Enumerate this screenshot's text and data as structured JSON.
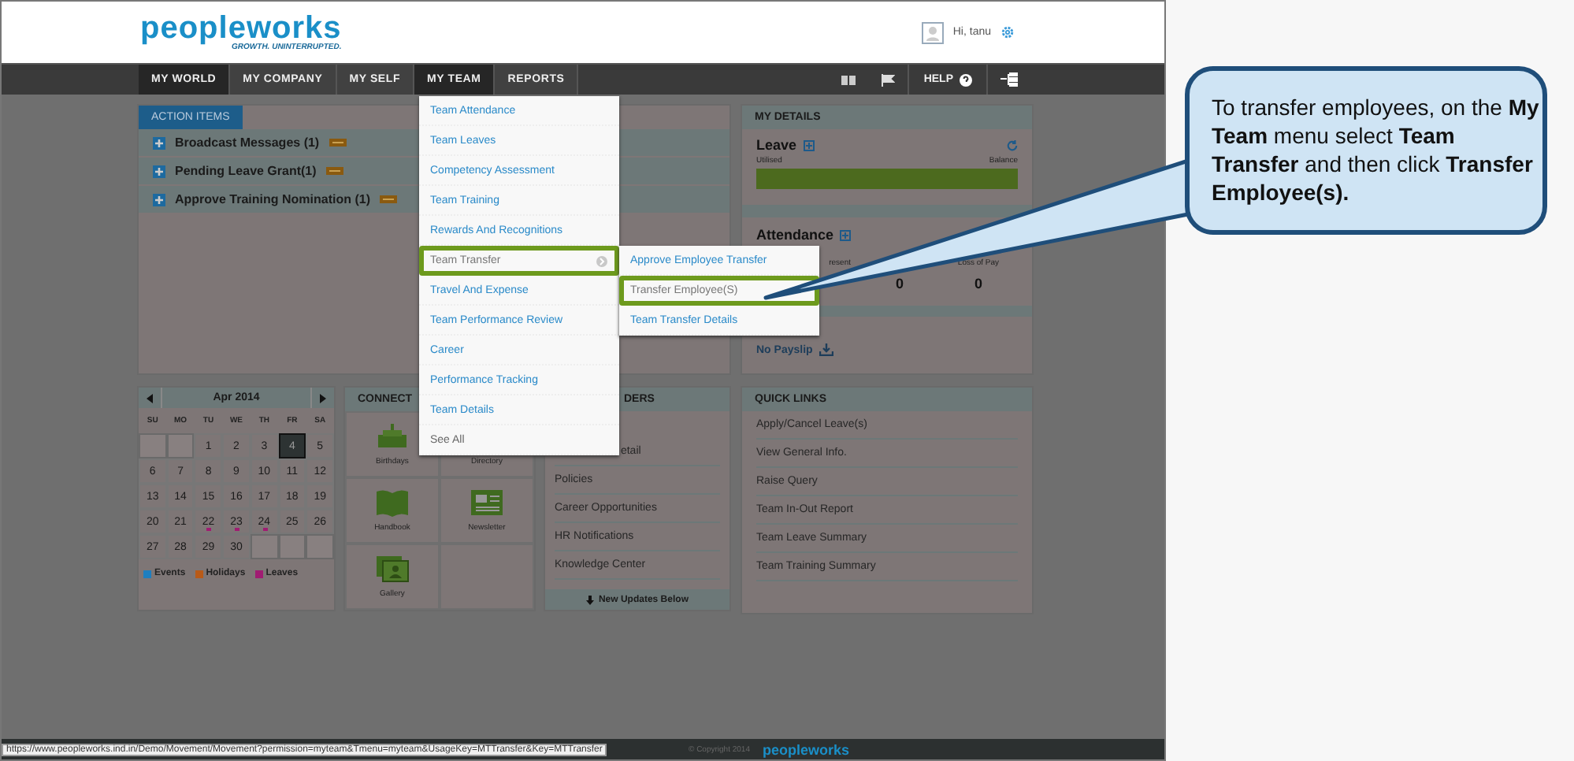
{
  "header": {
    "logo": "peopleworks",
    "tagline": "GROWTH. UNINTERRUPTED.",
    "greeting": "Hi, tanu"
  },
  "nav": {
    "items": [
      {
        "label": "MY WORLD",
        "active": true
      },
      {
        "label": "MY COMPANY",
        "active": false
      },
      {
        "label": "MY SELF",
        "active": false
      },
      {
        "label": "MY TEAM",
        "active": true
      },
      {
        "label": "REPORTS",
        "active": false
      }
    ],
    "help": "HELP"
  },
  "menu": {
    "items": [
      {
        "label": "Team Attendance",
        "kind": "link",
        "selected": false
      },
      {
        "label": "Team Leaves",
        "kind": "link",
        "selected": false
      },
      {
        "label": "Competency Assessment",
        "kind": "link",
        "selected": false
      },
      {
        "label": "Team Training",
        "kind": "link",
        "selected": false
      },
      {
        "label": "Rewards And Recognitions",
        "kind": "link",
        "selected": false
      },
      {
        "label": "Team Transfer",
        "kind": "submenu",
        "selected": true
      },
      {
        "label": "Travel And Expense",
        "kind": "link",
        "selected": false
      },
      {
        "label": "Team Performance Review",
        "kind": "link",
        "selected": false
      },
      {
        "label": "Career",
        "kind": "link",
        "selected": false
      },
      {
        "label": "Performance Tracking",
        "kind": "link",
        "selected": false
      },
      {
        "label": "Team Details",
        "kind": "link",
        "selected": false
      },
      {
        "label": "See All",
        "kind": "more",
        "selected": false
      }
    ],
    "submenu": [
      {
        "label": "Approve Employee Transfer",
        "selected": false
      },
      {
        "label": "Transfer Employee(S)",
        "selected": true
      },
      {
        "label": "Team Transfer Details",
        "selected": false
      }
    ]
  },
  "action_items": {
    "tab": "ACTION ITEMS",
    "rows": [
      {
        "label": "Broadcast Messages (1)",
        "new": true
      },
      {
        "label": "Pending Leave Grant(1)",
        "new": true
      },
      {
        "label": "Approve Training Nomination (1)",
        "new": true
      }
    ]
  },
  "calendar": {
    "month": "Apr 2014",
    "weekdays": [
      "SU",
      "MO",
      "TU",
      "WE",
      "TH",
      "FR",
      "SA"
    ],
    "weeks": [
      [
        {
          "kind": "blank"
        },
        {
          "kind": "blank"
        },
        {
          "kind": "day",
          "day": "1",
          "selected": false,
          "leave": false
        },
        {
          "kind": "day",
          "day": "2",
          "selected": false,
          "leave": false
        },
        {
          "kind": "day",
          "day": "3",
          "selected": false,
          "leave": false
        },
        {
          "kind": "day",
          "day": "4",
          "selected": true,
          "leave": false
        },
        {
          "kind": "day",
          "day": "5",
          "selected": false,
          "leave": false
        }
      ],
      [
        {
          "kind": "day",
          "day": "6",
          "selected": false,
          "leave": false
        },
        {
          "kind": "day",
          "day": "7",
          "selected": false,
          "leave": false
        },
        {
          "kind": "day",
          "day": "8",
          "selected": false,
          "leave": false
        },
        {
          "kind": "day",
          "day": "9",
          "selected": false,
          "leave": false
        },
        {
          "kind": "day",
          "day": "10",
          "selected": false,
          "leave": false
        },
        {
          "kind": "day",
          "day": "11",
          "selected": false,
          "leave": false
        },
        {
          "kind": "day",
          "day": "12",
          "selected": false,
          "leave": false
        }
      ],
      [
        {
          "kind": "day",
          "day": "13",
          "selected": false,
          "leave": false
        },
        {
          "kind": "day",
          "day": "14",
          "selected": false,
          "leave": false
        },
        {
          "kind": "day",
          "day": "15",
          "selected": false,
          "leave": false
        },
        {
          "kind": "day",
          "day": "16",
          "selected": false,
          "leave": false
        },
        {
          "kind": "day",
          "day": "17",
          "selected": false,
          "leave": false
        },
        {
          "kind": "day",
          "day": "18",
          "selected": false,
          "leave": false
        },
        {
          "kind": "day",
          "day": "19",
          "selected": false,
          "leave": false
        }
      ],
      [
        {
          "kind": "day",
          "day": "20",
          "selected": false,
          "leave": false
        },
        {
          "kind": "day",
          "day": "21",
          "selected": false,
          "leave": false
        },
        {
          "kind": "day",
          "day": "22",
          "selected": false,
          "leave": true
        },
        {
          "kind": "day",
          "day": "23",
          "selected": false,
          "leave": true
        },
        {
          "kind": "day",
          "day": "24",
          "selected": false,
          "leave": true
        },
        {
          "kind": "day",
          "day": "25",
          "selected": false,
          "leave": false
        },
        {
          "kind": "day",
          "day": "26",
          "selected": false,
          "leave": false
        }
      ],
      [
        {
          "kind": "day",
          "day": "27",
          "selected": false,
          "leave": false
        },
        {
          "kind": "day",
          "day": "28",
          "selected": false,
          "leave": false
        },
        {
          "kind": "day",
          "day": "29",
          "selected": false,
          "leave": false
        },
        {
          "kind": "day",
          "day": "30",
          "selected": false,
          "leave": false
        },
        {
          "kind": "blank"
        },
        {
          "kind": "blank"
        },
        {
          "kind": "blank"
        }
      ]
    ],
    "legend": [
      {
        "label": "Events",
        "color": "#1e7fc0"
      },
      {
        "label": "Holidays",
        "color": "#b85a18"
      },
      {
        "label": "Leaves",
        "color": "#a01c72"
      }
    ]
  },
  "connect": {
    "title": "CONNECT",
    "tiles": [
      {
        "label": "Birthdays",
        "kind": "cake"
      },
      {
        "label": "Directory",
        "kind": "hidden"
      },
      {
        "label": "Handbook",
        "kind": "book"
      },
      {
        "label": "Newsletter",
        "kind": "news"
      },
      {
        "label": "Gallery",
        "kind": "gallery"
      }
    ]
  },
  "reminders": {
    "title": "DERS",
    "items": [
      "etail",
      "Policies",
      "Career Opportunities",
      "HR Notifications",
      "Knowledge Center"
    ],
    "footer": "New Updates Below"
  },
  "my_details": {
    "title": "MY DETAILS",
    "leave": {
      "title": "Leave",
      "utilised": "Utilised",
      "balance": "Balance"
    },
    "attendance": {
      "title": "Attendance",
      "columns": [
        {
          "label": "resent"
        },
        {
          "value": "0"
        },
        {
          "label": "Loss of Pay",
          "value": "0"
        }
      ]
    },
    "payslip": "No Payslip"
  },
  "quick_links": {
    "title": "QUICK LINKS",
    "items": [
      "Apply/Cancel Leave(s)",
      "View General Info.",
      "Raise Query",
      "Team In-Out Report",
      "Team Leave Summary",
      "Team Training Summary"
    ]
  },
  "status_bar": {
    "url": "https://www.peopleworks.ind.in/Demo/Movement/Movement?permission=myteam&Tmenu=myteam&UsageKey=MTTransfer&Key=MTTransfer",
    "copyright": "© Copyright 2014",
    "logo": "peopleworks"
  },
  "callout": {
    "text": "To transfer employees, on the **My Team** menu select **Team Transfer** and then click **Transfer Employee(s).**"
  }
}
